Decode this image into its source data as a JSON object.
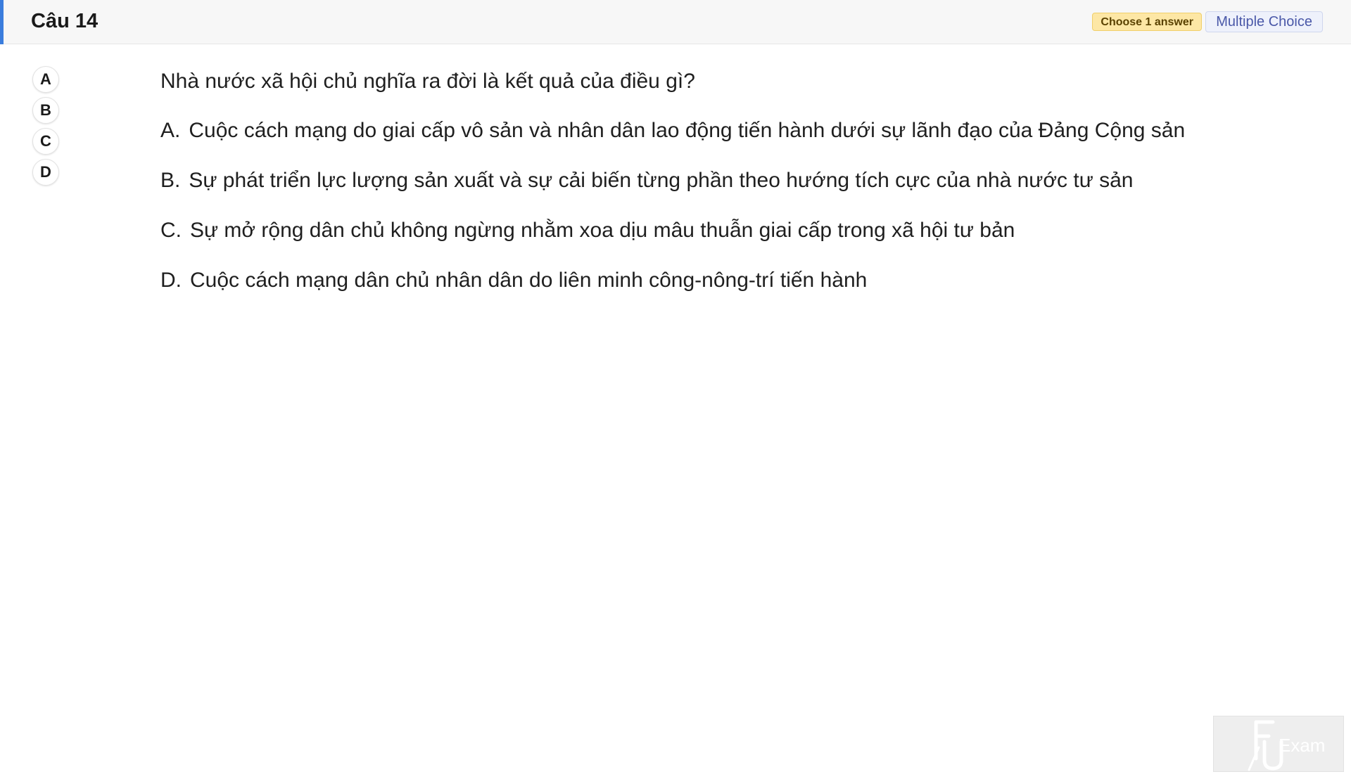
{
  "header": {
    "question_number": "Câu 14",
    "badge_answer": "Choose 1 answer",
    "badge_type": "Multiple Choice"
  },
  "answer_picker": {
    "options": [
      "A",
      "B",
      "C",
      "D"
    ]
  },
  "question": {
    "stem": "Nhà nước xã hội chủ nghĩa ra đời là kết quả của điều gì?",
    "options": [
      {
        "letter": "A.",
        "text": "Cuộc cách mạng do giai cấp vô sản và nhân dân lao động tiến hành dưới sự lãnh đạo của Đảng Cộng sản"
      },
      {
        "letter": "B.",
        "text": "Sự phát triển lực lượng sản xuất và sự cải biến từng phần theo hướng tích cực của nhà nước tư sản"
      },
      {
        "letter": "C.",
        "text": "Sự mở rộng dân chủ không ngừng nhằm xoa dịu mâu thuẫn giai cấp trong xã hội tư bản"
      },
      {
        "letter": "D.",
        "text": "Cuộc cách mạng dân chủ nhân dân do liên minh công-nông-trí tiến hành"
      }
    ]
  },
  "watermark": {
    "logo_text": "Exam",
    "icon": "fu-exam-logo-icon"
  },
  "colors": {
    "accent": "#3b7ddd",
    "badge_answer_bg": "#fde7a5",
    "badge_type_text": "#4a58a8"
  }
}
